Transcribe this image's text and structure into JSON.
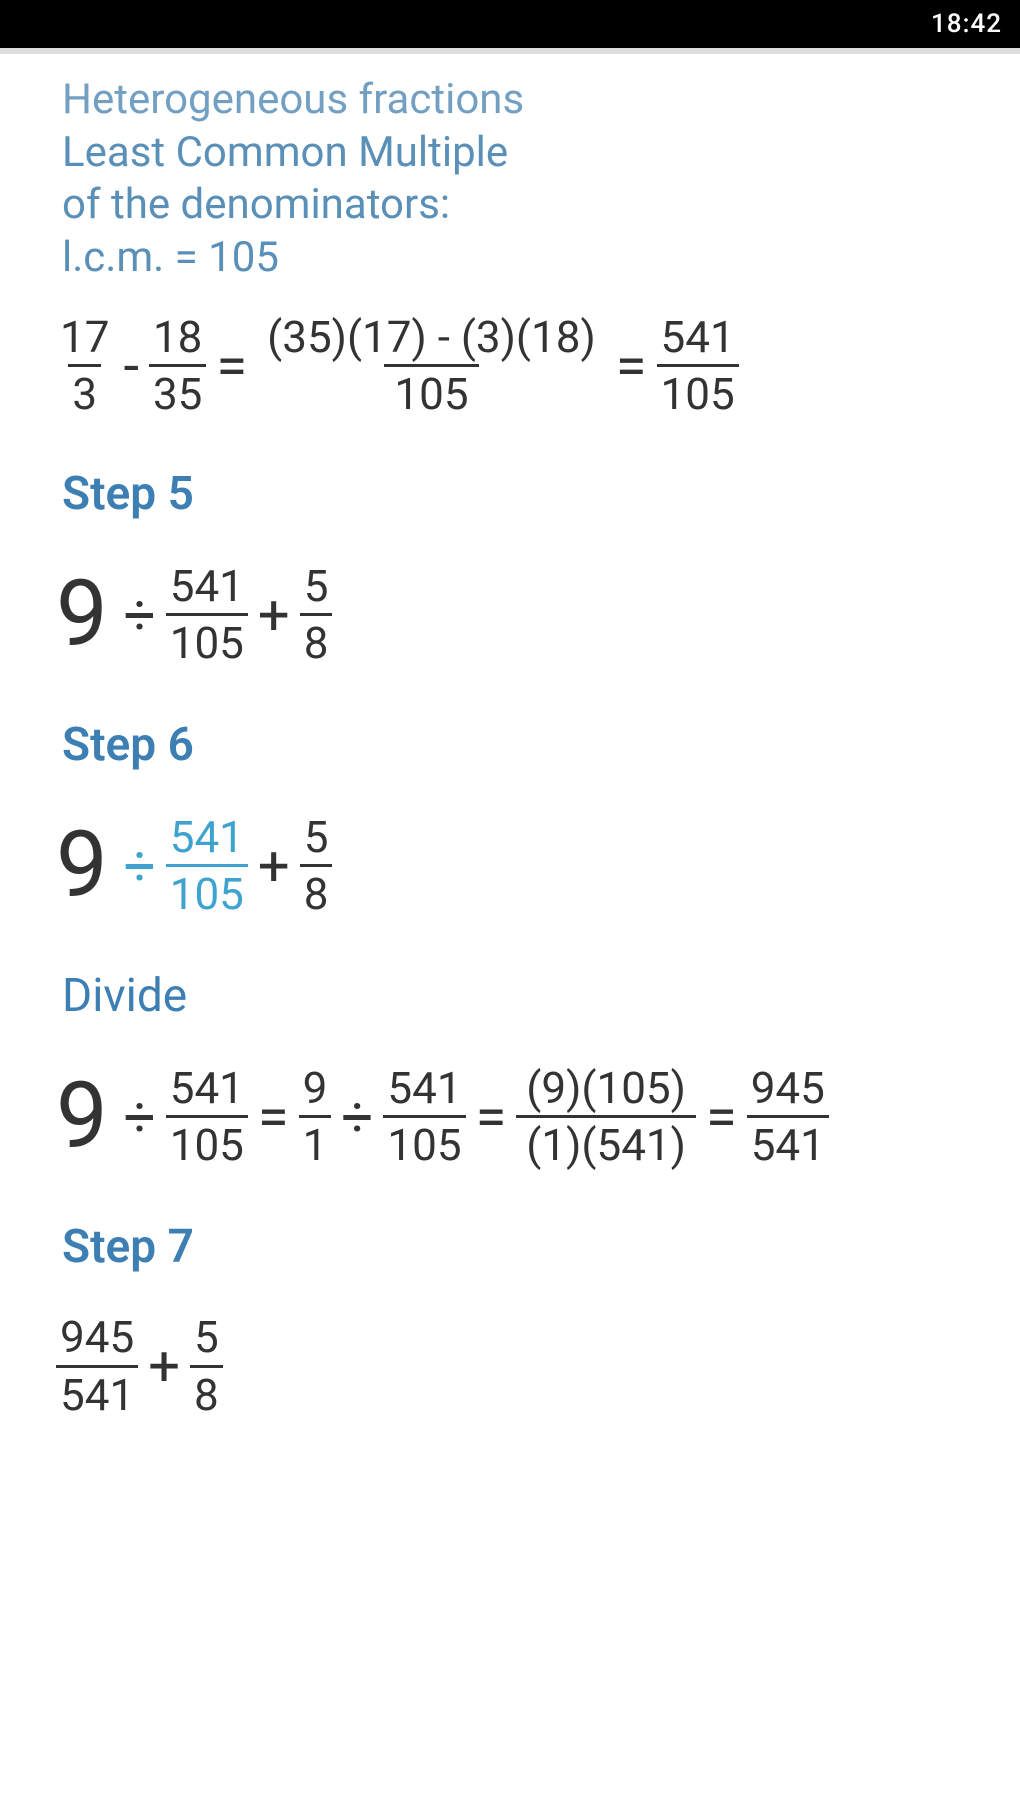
{
  "status": {
    "time": "18:42"
  },
  "intro": {
    "line1": "Heterogeneous fractions",
    "line2": "Least Common Multiple",
    "line3": "of the denominators:",
    "line4": "l.c.m. = 105"
  },
  "row1": {
    "f1": {
      "n": "17",
      "d": "3"
    },
    "op1": "-",
    "f2": {
      "n": "18",
      "d": "35"
    },
    "eq1": "=",
    "f3": {
      "n": "(35)(17) - (3)(18)",
      "d": "105"
    },
    "eq2": "=",
    "f4": {
      "n": "541",
      "d": "105"
    }
  },
  "step5": {
    "title": "Step 5",
    "big": "9",
    "op1": "÷",
    "f1": {
      "n": "541",
      "d": "105"
    },
    "op2": "+",
    "f2": {
      "n": "5",
      "d": "8"
    }
  },
  "step6": {
    "title": "Step 6",
    "big": "9",
    "op1": "÷",
    "f1": {
      "n": "541",
      "d": "105"
    },
    "op2": "+",
    "f2": {
      "n": "5",
      "d": "8"
    }
  },
  "divide": {
    "title": "Divide",
    "big": "9",
    "op1": "÷",
    "f1": {
      "n": "541",
      "d": "105"
    },
    "eq1": "=",
    "f2": {
      "n": "9",
      "d": "1"
    },
    "op2": "÷",
    "f3": {
      "n": "541",
      "d": "105"
    },
    "eq2": "=",
    "f4": {
      "n": "(9)(105)",
      "d": "(1)(541)"
    },
    "eq3": "=",
    "f5": {
      "n": "945",
      "d": "541"
    }
  },
  "step7": {
    "title": "Step 7",
    "f1": {
      "n": "945",
      "d": "541"
    },
    "op1": "+",
    "f2": {
      "n": "5",
      "d": "8"
    }
  }
}
